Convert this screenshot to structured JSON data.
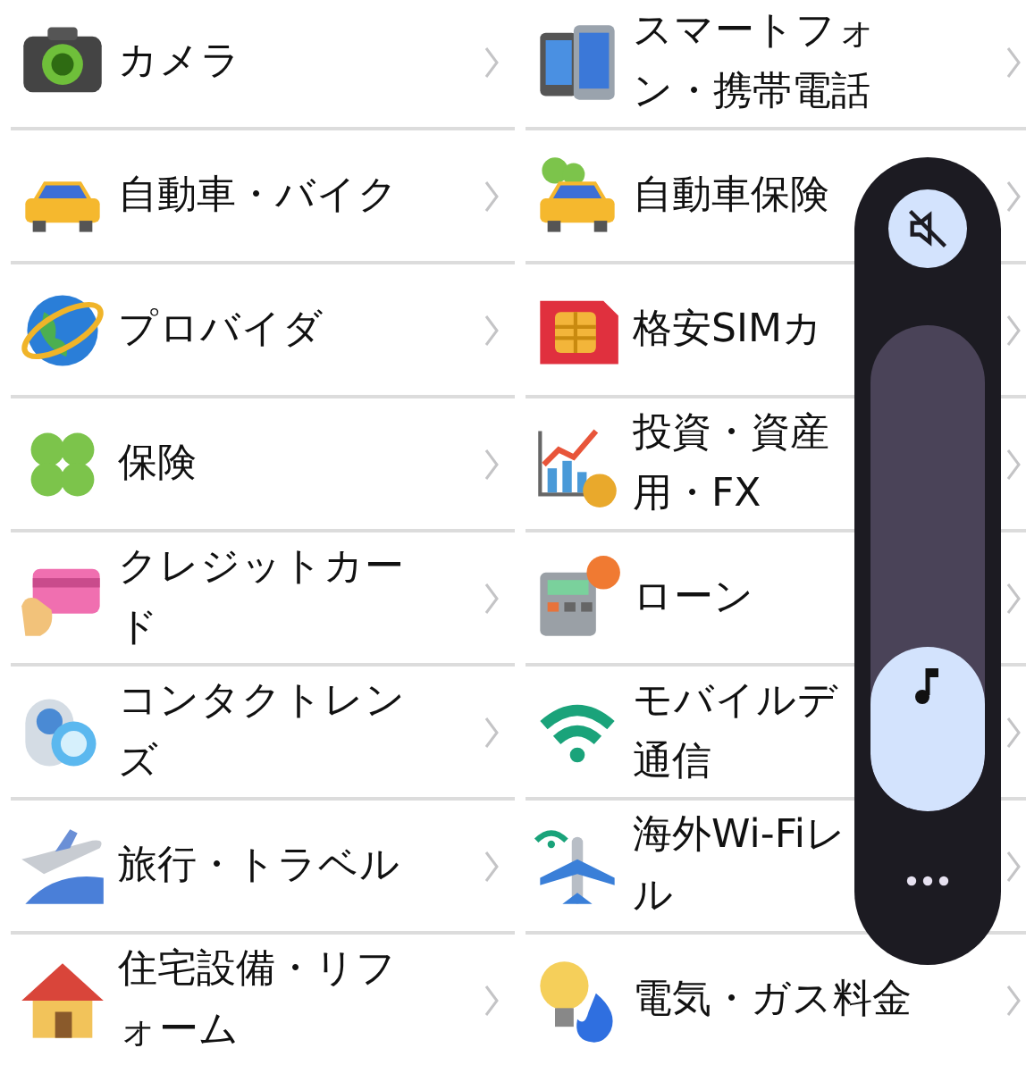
{
  "category_rows": [
    [
      {
        "lines": [
          "カメラ"
        ]
      },
      {
        "lines": [
          "スマートフォ",
          "ン・携帯電話"
        ]
      }
    ],
    [
      {
        "lines": [
          "自動車・バイク"
        ]
      },
      {
        "lines": [
          "自動車保険"
        ]
      }
    ],
    [
      {
        "lines": [
          "プロバイダ"
        ]
      },
      {
        "lines": [
          "格安SIMカ"
        ]
      }
    ],
    [
      {
        "lines": [
          "保険"
        ]
      },
      {
        "lines": [
          "投資・資産",
          "用・FX"
        ]
      }
    ],
    [
      {
        "lines": [
          "クレジットカー",
          "ド"
        ]
      },
      {
        "lines": [
          "ローン"
        ]
      }
    ],
    [
      {
        "lines": [
          "コンタクトレン",
          "ズ"
        ]
      },
      {
        "lines": [
          "モバイルデ",
          "通信"
        ]
      }
    ],
    [
      {
        "lines": [
          "旅行・トラベル"
        ]
      },
      {
        "lines": [
          "海外Wi-Fiレ",
          "ル"
        ]
      }
    ],
    [
      {
        "lines": [
          "住宅設備・リフ",
          "ォーム"
        ]
      },
      {
        "lines": [
          "電気・ガス料金"
        ]
      }
    ]
  ],
  "volume_panel": {
    "muted": true,
    "level": 0.34
  }
}
